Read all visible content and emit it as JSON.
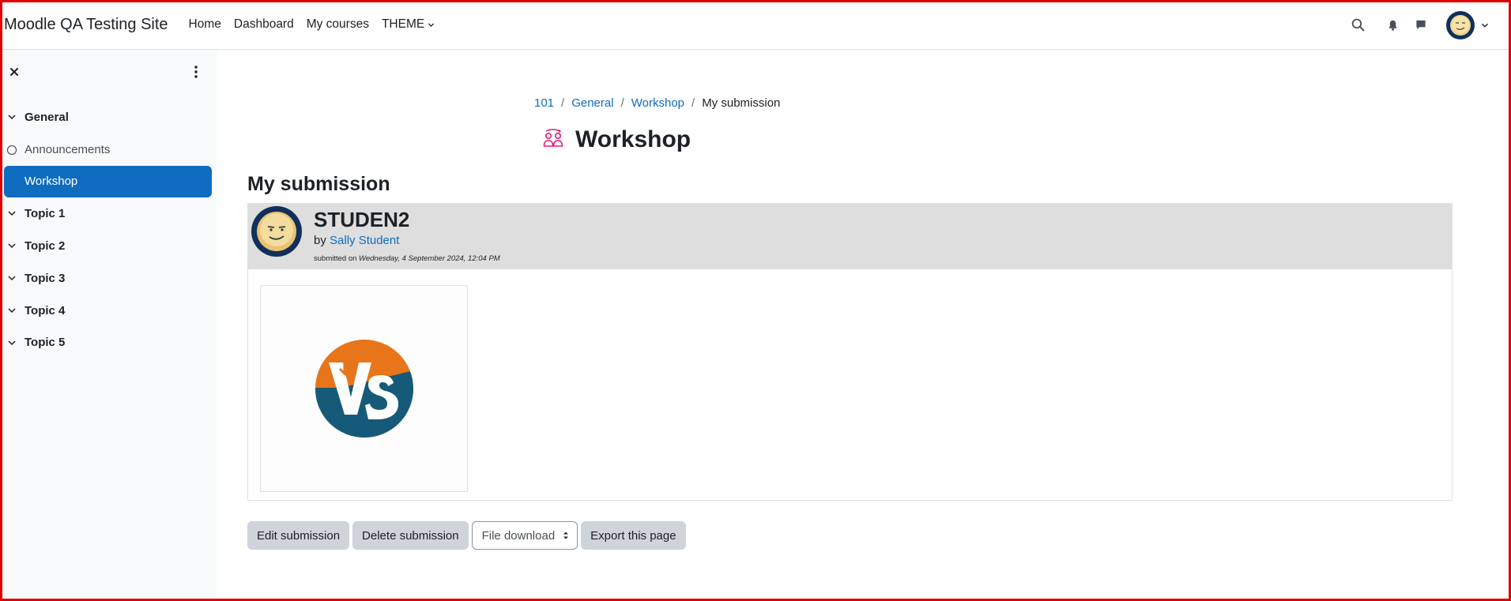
{
  "navbar": {
    "brand": "Moodle QA Testing Site",
    "links": [
      "Home",
      "Dashboard",
      "My courses"
    ],
    "theme_label": "THEME"
  },
  "drawer": {
    "sections": [
      {
        "label": "General"
      },
      {
        "label": "Topic 1"
      },
      {
        "label": "Topic 2"
      },
      {
        "label": "Topic 3"
      },
      {
        "label": "Topic 4"
      },
      {
        "label": "Topic 5"
      }
    ],
    "activities": [
      {
        "label": "Announcements"
      },
      {
        "label": "Workshop"
      }
    ]
  },
  "breadcrumb": {
    "items": [
      "101",
      "General",
      "Workshop"
    ],
    "current": "My submission",
    "separator": "/"
  },
  "page": {
    "title": "Workshop",
    "section_title": "My submission"
  },
  "submission": {
    "title": "STUDEN2",
    "by_prefix": "by",
    "author": "Sally Student",
    "submitted_prefix": "submitted on",
    "submitted_date": "Wednesday, 4 September 2024, 12:04 PM"
  },
  "actions": {
    "edit": "Edit submission",
    "delete": "Delete submission",
    "download_select": "File download",
    "export": "Export this page"
  },
  "colors": {
    "accent": "#0f6cbf",
    "workshop_icon": "#e6197a",
    "vs_orange": "#e8751a",
    "vs_teal": "#165a79"
  },
  "icons": [
    "search-icon",
    "bell-icon",
    "message-icon",
    "close-icon",
    "more-vertical-icon",
    "chevron-down-icon",
    "workshop-icon"
  ]
}
